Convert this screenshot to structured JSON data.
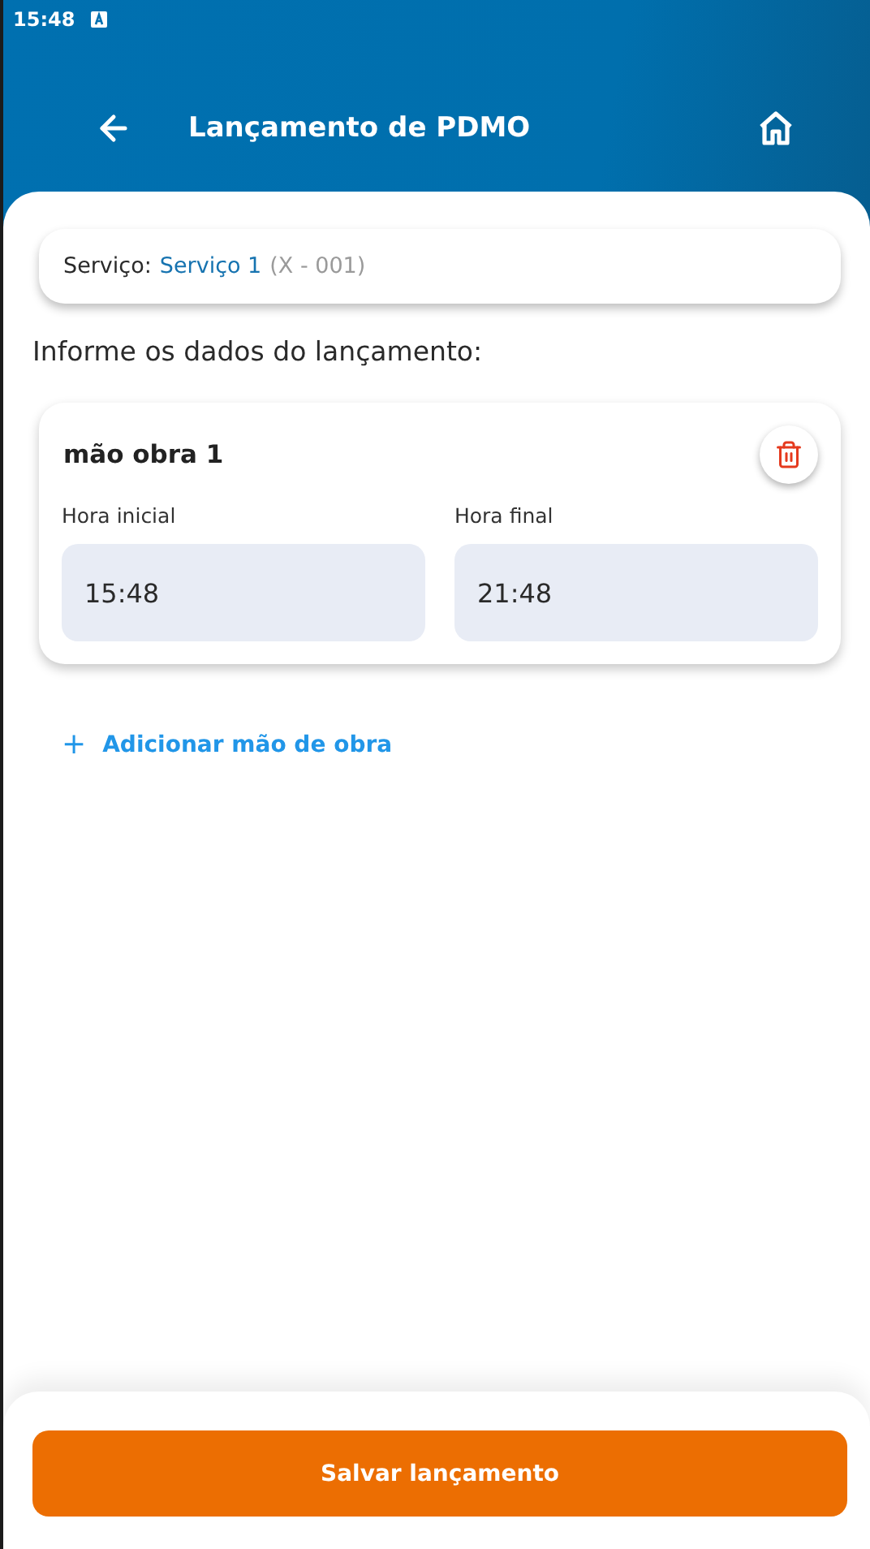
{
  "status_bar": {
    "time": "15:48"
  },
  "header": {
    "title": "Lançamento de PDMO"
  },
  "service": {
    "label": "Serviço:",
    "name": "Serviço 1",
    "code": "(X - 001)"
  },
  "section_title": "Informe os dados do lançamento:",
  "labor_entries": [
    {
      "title": "mão obra 1",
      "fields": [
        {
          "label": "Hora inicial",
          "value": "15:48"
        },
        {
          "label": "Hora final",
          "value": "21:48"
        }
      ]
    }
  ],
  "add_link": {
    "icon": "+",
    "label": "Adicionar mão de obra"
  },
  "save_button": {
    "label": "Salvar lançamento"
  }
}
